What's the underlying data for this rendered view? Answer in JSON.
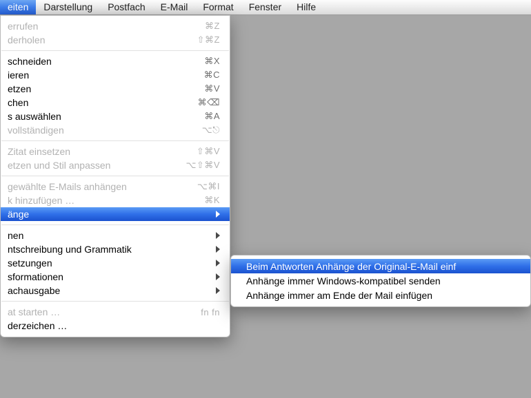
{
  "menubar": {
    "items": [
      {
        "label": "eiten",
        "active": true
      },
      {
        "label": "Darstellung"
      },
      {
        "label": "Postfach"
      },
      {
        "label": "E-Mail"
      },
      {
        "label": "Format"
      },
      {
        "label": "Fenster"
      },
      {
        "label": "Hilfe"
      }
    ]
  },
  "dropdown": {
    "groups": [
      [
        {
          "label": "errufen",
          "shortcut": "⌘Z",
          "disabled": true
        },
        {
          "label": "derholen",
          "shortcut": "⇧⌘Z",
          "disabled": true
        }
      ],
      [
        {
          "label": "schneiden",
          "shortcut": "⌘X"
        },
        {
          "label": "ieren",
          "shortcut": "⌘C"
        },
        {
          "label": "etzen",
          "shortcut": "⌘V"
        },
        {
          "label": "chen",
          "shortcut": "⌘⌫"
        },
        {
          "label": "s auswählen",
          "shortcut": "⌘A"
        },
        {
          "label": "vollständigen",
          "shortcut": "⌥⎋",
          "disabled": true
        }
      ],
      [
        {
          "label": "Zitat einsetzen",
          "shortcut": "⇧⌘V",
          "disabled": true
        },
        {
          "label": "etzen und Stil anpassen",
          "shortcut": "⌥⇧⌘V",
          "disabled": true
        }
      ],
      [
        {
          "label": "gewählte E-Mails anhängen",
          "shortcut": "⌥⌘I",
          "disabled": true
        },
        {
          "label": "k hinzufügen …",
          "shortcut": "⌘K",
          "disabled": true
        },
        {
          "label": "änge",
          "submenu": true,
          "highlight": true
        }
      ],
      [
        {
          "label": "nen",
          "submenu": true
        },
        {
          "label": "ntschreibung und Grammatik",
          "submenu": true
        },
        {
          "label": "setzungen",
          "submenu": true
        },
        {
          "label": "sformationen",
          "submenu": true
        },
        {
          "label": "achausgabe",
          "submenu": true
        }
      ],
      [
        {
          "label": "at starten …",
          "shortcut": "fn fn",
          "disabled": true
        },
        {
          "label": "derzeichen …"
        }
      ]
    ]
  },
  "submenu": {
    "items": [
      {
        "label": "Beim Antworten Anhänge der Original-E-Mail einf",
        "highlight": true
      },
      {
        "label": "Anhänge immer Windows-kompatibel senden"
      },
      {
        "label": "Anhänge immer am Ende der Mail einfügen"
      }
    ]
  }
}
